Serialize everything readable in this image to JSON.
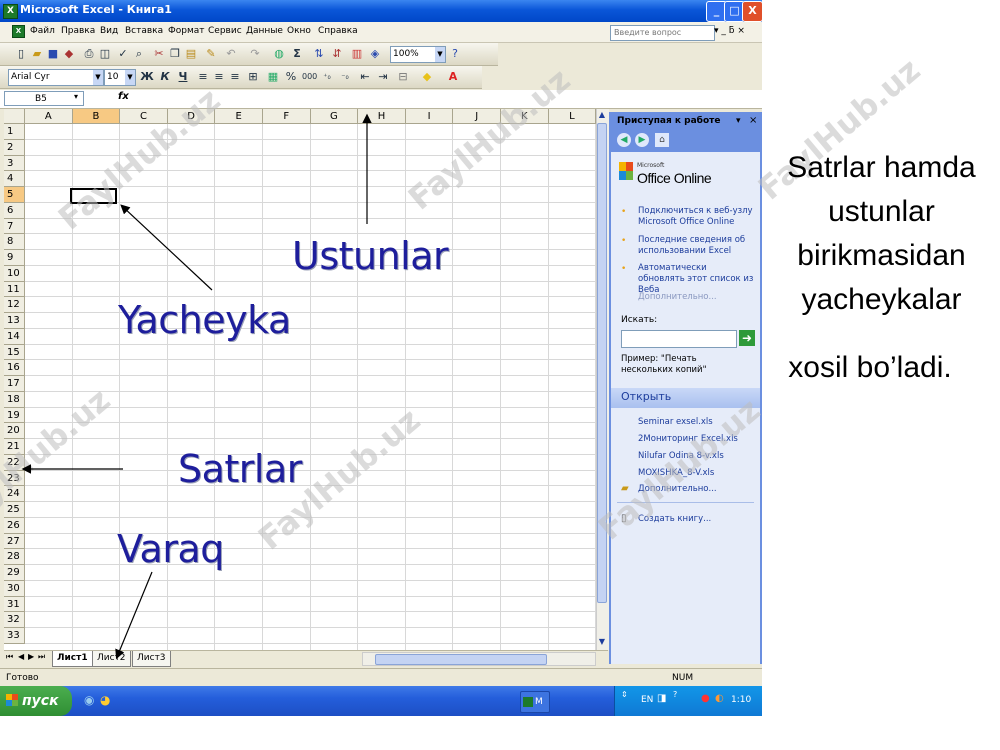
{
  "window": {
    "title": "Microsoft Excel - Книга1",
    "minimize": "_",
    "maximize": "□",
    "close": "X"
  },
  "menu": {
    "items": [
      "Файл",
      "Правка",
      "Вид",
      "Вставка",
      "Формат",
      "Сервис",
      "Данные",
      "Окно",
      "Справка"
    ],
    "ask_placeholder": "Введите вопрос",
    "doc_controls": "▾ _ ƃ ×"
  },
  "toolbar_standard": {
    "zoom": "100%",
    "sigma": "Σ"
  },
  "toolbar_format": {
    "font": "Arial Cyr",
    "size": "10",
    "bold": "Ж",
    "italic": "К",
    "underline": "Ч",
    "percent": "%",
    "thousands": "000"
  },
  "formula_bar": {
    "name_box": "B5",
    "fx": "fx"
  },
  "grid": {
    "columns": [
      "A",
      "B",
      "C",
      "D",
      "E",
      "F",
      "G",
      "H",
      "I",
      "J",
      "K",
      "L"
    ],
    "selected_column": "B",
    "rows": [
      "1",
      "2",
      "3",
      "4",
      "5",
      "6",
      "7",
      "8",
      "9",
      "10",
      "11",
      "12",
      "13",
      "14",
      "15",
      "16",
      "17",
      "18",
      "19",
      "20",
      "21",
      "22",
      "23",
      "24",
      "25",
      "26",
      "27",
      "28",
      "29",
      "30",
      "31",
      "32",
      "33"
    ],
    "selected_row": "5"
  },
  "sheet_tabs": [
    "Лист1",
    "Лист2",
    "Лист3"
  ],
  "status": {
    "ready": "Готово",
    "num": "NUM"
  },
  "task_pane": {
    "title": "Приступая к работе",
    "office_small": "Microsoft",
    "office_logo": "Office Online",
    "links": [
      "Подключиться к веб-узлу Microsoft Office Online",
      "Последние сведения об использовании Excel",
      "Автоматически обновлять этот список из Веба"
    ],
    "more": "Дополнительно...",
    "search_label": "Искать:",
    "example": "Пример: \"Печать нескольких копий\"",
    "open_header": "Открыть",
    "files": [
      "Seminar exsel.xls",
      "2Мониторинг Excel.xls",
      "Nilufar Odina 8-v.xls",
      "MOXISHKA_8-V.xls"
    ],
    "open_more": "Дополнительно...",
    "create": "Создать книгу..."
  },
  "taskbar": {
    "start": "пуск",
    "task": "M",
    "lang": "EN",
    "clock": "1:10"
  },
  "annotations": {
    "columns": "Ustunlar",
    "cell": "Yacheyka",
    "rows": "Satrlar",
    "sheet": "Varaq"
  },
  "side_text": {
    "line1": "Satrlar hamda",
    "line2": "ustunlar",
    "line3": "birikmasidan",
    "line4": "yacheykalar",
    "line5": "xosil bo’ladi."
  },
  "watermark": "FaylHub.uz"
}
